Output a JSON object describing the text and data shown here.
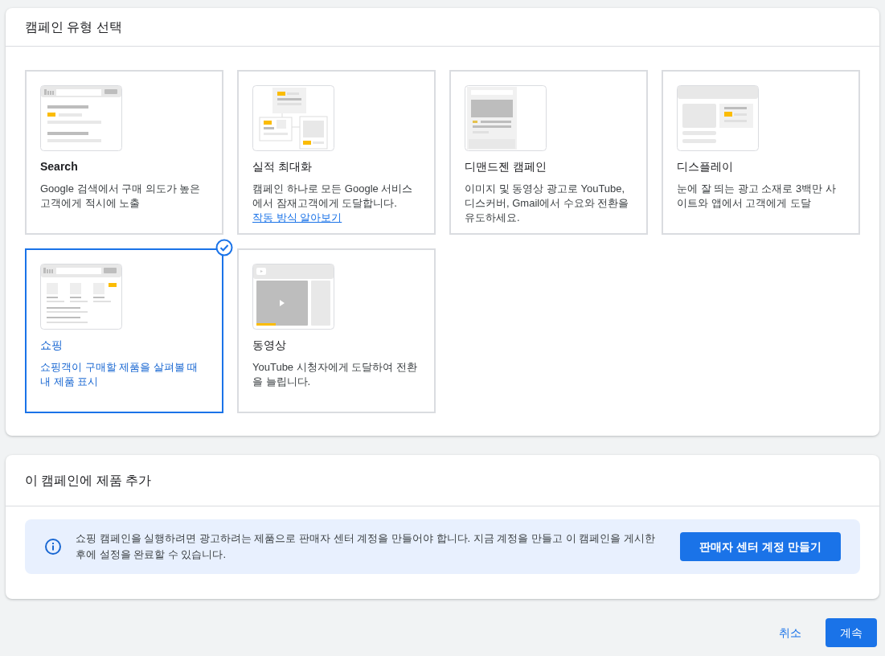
{
  "campaign_type_panel": {
    "title": "캠페인 유형 선택",
    "cards": [
      {
        "kind": "search",
        "title": "Search",
        "description": "Google 검색에서 구매 의도가 높은 고객에게 적시에 노출",
        "selected": false
      },
      {
        "kind": "pmax",
        "title": "실적 최대화",
        "description": "캠페인 하나로 모든 Google 서비스에서 잠재고객에게 도달합니다.",
        "link": "작동 방식 알아보기",
        "selected": false
      },
      {
        "kind": "demandgen",
        "title": "디맨드젠 캠페인",
        "description": "이미지 및 동영상 광고로 YouTube, 디스커버, Gmail에서 수요와 전환을 유도하세요.",
        "selected": false
      },
      {
        "kind": "display",
        "title": "디스플레이",
        "description": "눈에 잘 띄는 광고 소재로 3백만 사이트와 앱에서 고객에게 도달",
        "selected": false
      },
      {
        "kind": "shopping",
        "title": "쇼핑",
        "description": "쇼핑객이 구매할 제품을 살펴볼 때 내 제품 표시",
        "selected": true
      },
      {
        "kind": "video",
        "title": "동영상",
        "description": "YouTube 시청자에게 도달하여 전환을 늘립니다.",
        "selected": false
      }
    ]
  },
  "products_panel": {
    "title": "이 캠페인에 제품 추가",
    "notice": "쇼핑 캠페인을 실행하려면 광고하려는 제품으로 판매자 센터 계정을 만들어야 합니다. 지금 계정을 만들고 이 캠페인을 게시한 후에 설정을 완료할 수 있습니다.",
    "button": "판매자 센터 계정 만들기"
  },
  "footer_buttons": [
    "취소",
    "계속"
  ]
}
